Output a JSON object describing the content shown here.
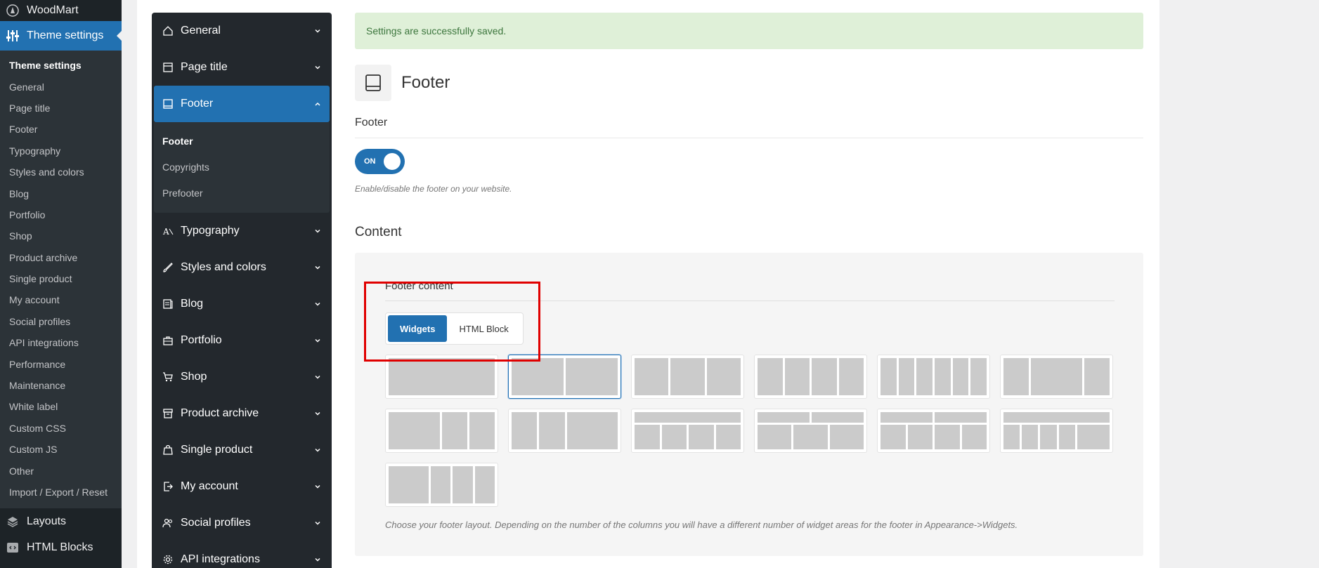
{
  "wp": {
    "site_name": "WoodMart",
    "active_menu": "Theme settings",
    "submenu": [
      "Theme settings",
      "General",
      "Page title",
      "Footer",
      "Typography",
      "Styles and colors",
      "Blog",
      "Portfolio",
      "Shop",
      "Product archive",
      "Single product",
      "My account",
      "Social profiles",
      "API integrations",
      "Performance",
      "Maintenance",
      "White label",
      "Custom CSS",
      "Custom JS",
      "Other",
      "Import / Export / Reset"
    ],
    "bottom_menu": [
      {
        "label": "Layouts",
        "icon": "layers-icon"
      },
      {
        "label": "HTML Blocks",
        "icon": "code-block-icon"
      }
    ]
  },
  "panel": {
    "items_before": [
      {
        "label": "General",
        "icon": "home-icon"
      },
      {
        "label": "Page title",
        "icon": "page-title-icon"
      }
    ],
    "active": {
      "label": "Footer",
      "icon": "footer-icon"
    },
    "active_sub": [
      "Footer",
      "Copyrights",
      "Prefooter"
    ],
    "items_after": [
      {
        "label": "Typography",
        "icon": "typography-icon"
      },
      {
        "label": "Styles and colors",
        "icon": "brush-icon"
      },
      {
        "label": "Blog",
        "icon": "blog-icon"
      },
      {
        "label": "Portfolio",
        "icon": "briefcase-icon"
      },
      {
        "label": "Shop",
        "icon": "cart-icon"
      },
      {
        "label": "Product archive",
        "icon": "archive-icon"
      },
      {
        "label": "Single product",
        "icon": "bag-icon"
      },
      {
        "label": "My account",
        "icon": "account-icon"
      },
      {
        "label": "Social profiles",
        "icon": "users-icon"
      },
      {
        "label": "API integrations",
        "icon": "gear-icon"
      }
    ]
  },
  "main": {
    "notice": "Settings are successfully saved.",
    "title": "Footer",
    "footer_label": "Footer",
    "toggle_text": "ON",
    "footer_desc": "Enable/disable the footer on your website.",
    "content_heading": "Content",
    "footer_content_label": "Footer content",
    "buttons": {
      "widgets": "Widgets",
      "html_block": "HTML Block"
    },
    "layout_desc": "Choose your footer layout. Depending on the number of the columns you will have a different number of widget areas for the footer in Appearance->Widgets."
  },
  "colors": {
    "accent": "#2271b1",
    "highlight": "#e00000",
    "notice_bg": "#dff0d8",
    "notice_text": "#3c763d"
  }
}
